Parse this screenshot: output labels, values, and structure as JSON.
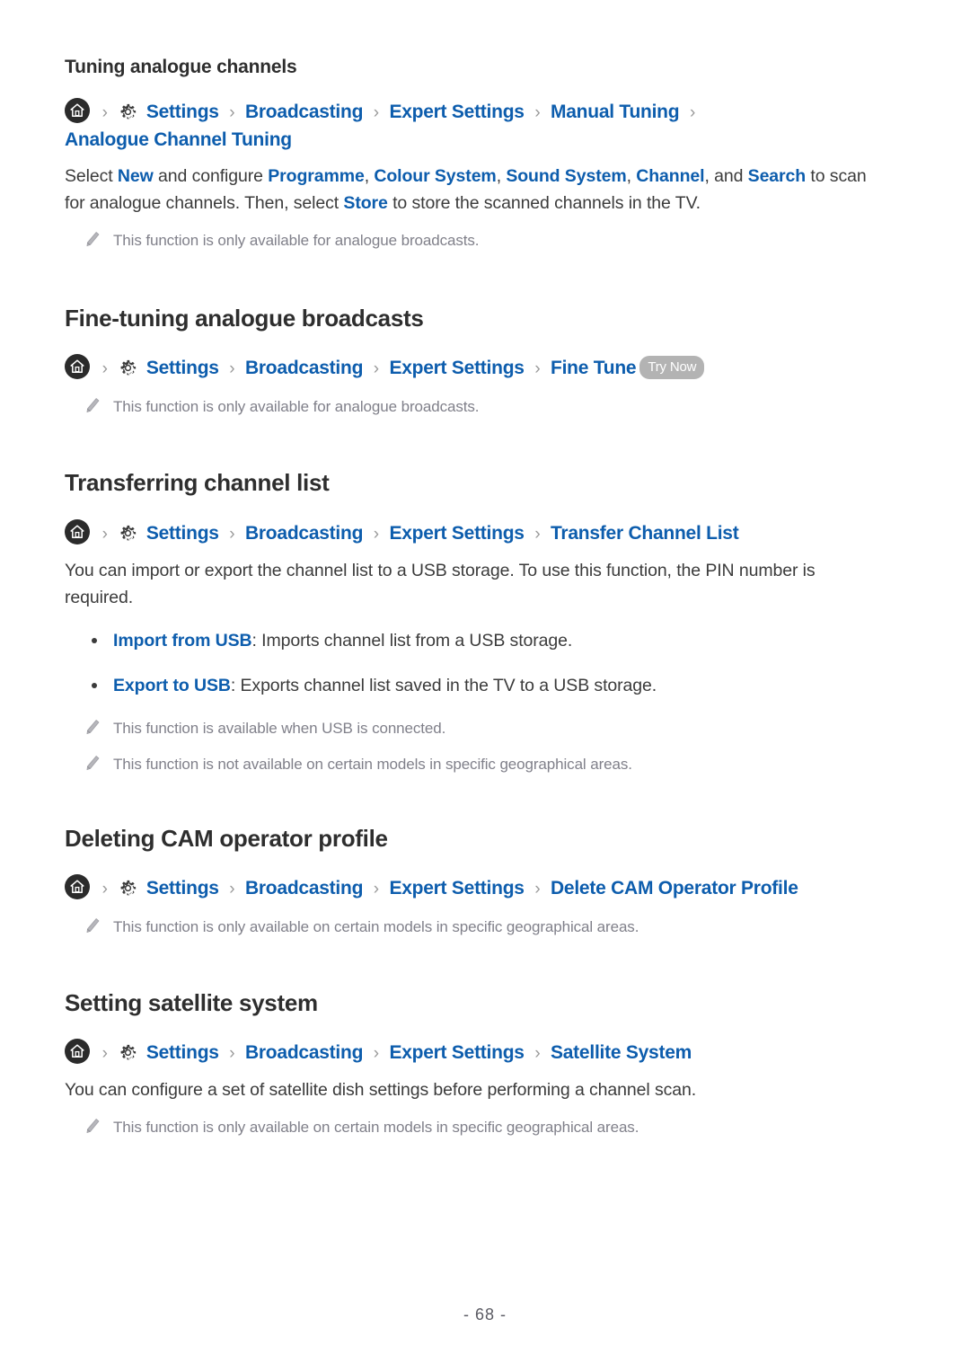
{
  "page": {
    "number_label": "- 68 -",
    "link_color": "#0d5dad",
    "heading_color": "#2e2e2e",
    "body_color": "#3b3b3b",
    "note_color": "#80808a",
    "badge_color": "#b3b3b3"
  },
  "icons": {
    "home": "home-icon",
    "gear": "gear-icon",
    "pencil": "pencil-icon",
    "separator": "›"
  },
  "sections": [
    {
      "id": "tuning-analogue-channels",
      "heading": "Tuning analogue channels",
      "heading_level": "sub",
      "breadcrumb": [
        "Settings",
        "Broadcasting",
        "Expert Settings",
        "Manual Tuning",
        "Analogue Channel Tuning"
      ],
      "body": {
        "p1_a": "Select ",
        "p1_l1": "New",
        "p1_b": " and configure ",
        "p1_l2": "Programme",
        "p1_c": ", ",
        "p1_l3": "Colour System",
        "p1_d": ", ",
        "p1_l4": "Sound System",
        "p1_e": ", ",
        "p1_l5": "Channel",
        "p1_f": ", and ",
        "p1_l6": "Search",
        "p1_g": " to scan for analogue channels. Then, select ",
        "p1_l7": "Store",
        "p1_h": " to store the scanned channels in the TV."
      },
      "notes": [
        "This function is only available for analogue broadcasts."
      ]
    },
    {
      "id": "fine-tuning-analogue-broadcasts",
      "heading": "Fine-tuning analogue broadcasts",
      "heading_level": "main",
      "breadcrumb": [
        "Settings",
        "Broadcasting",
        "Expert Settings",
        "Fine Tune"
      ],
      "badge": "Try Now",
      "notes": [
        "This function is only available for analogue broadcasts."
      ]
    },
    {
      "id": "transferring-channel-list",
      "heading": "Transferring channel list",
      "heading_level": "main",
      "breadcrumb": [
        "Settings",
        "Broadcasting",
        "Expert Settings",
        "Transfer Channel List"
      ],
      "paragraph": "You can import or export the channel list to a USB storage. To use this function, the PIN number is required.",
      "bullets": [
        {
          "term": "Import from USB",
          "text": ": Imports channel list from a USB storage."
        },
        {
          "term": "Export to USB",
          "text": ": Exports channel list saved in the TV to a USB storage."
        }
      ],
      "notes": [
        "This function is available when USB is connected.",
        "This function is not available on certain models in specific geographical areas."
      ]
    },
    {
      "id": "deleting-cam-operator-profile",
      "heading": "Deleting CAM operator profile",
      "heading_level": "main",
      "breadcrumb": [
        "Settings",
        "Broadcasting",
        "Expert Settings",
        "Delete CAM Operator Profile"
      ],
      "notes": [
        "This function is only available on certain models in specific geographical areas."
      ]
    },
    {
      "id": "setting-satellite-system",
      "heading": "Setting satellite system",
      "heading_level": "main",
      "breadcrumb": [
        "Settings",
        "Broadcasting",
        "Expert Settings",
        "Satellite System"
      ],
      "paragraph": "You can configure a set of satellite dish settings before performing a channel scan.",
      "notes": [
        "This function is only available on certain models in specific geographical areas."
      ]
    }
  ]
}
